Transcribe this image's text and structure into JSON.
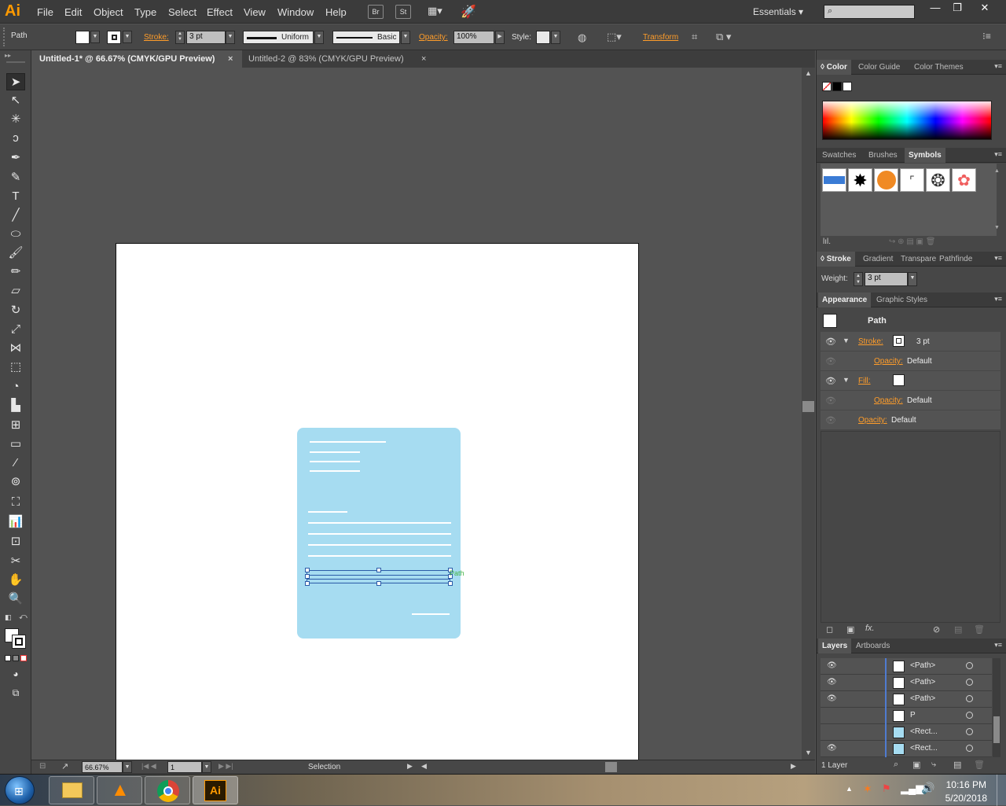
{
  "menubar": {
    "logo": "Ai",
    "items": [
      "File",
      "Edit",
      "Object",
      "Type",
      "Select",
      "Effect",
      "View",
      "Window",
      "Help"
    ],
    "bridge_icon": "Br",
    "stock_icon": "St",
    "workspace": "Essentials"
  },
  "controlbar": {
    "object_type": "Path",
    "stroke_label": "Stroke:",
    "stroke_weight": "3 pt",
    "profile_uniform": "Uniform",
    "brush_basic": "Basic",
    "opacity_label": "Opacity:",
    "opacity_value": "100%",
    "style_label": "Style:",
    "transform_label": "Transform"
  },
  "tabs": [
    {
      "label": "Untitled-1* @ 66.67% (CMYK/GPU Preview)",
      "close": "×"
    },
    {
      "label": "Untitled-2 @ 83% (CMYK/GPU Preview)",
      "close": "×"
    }
  ],
  "canvas": {
    "selection_hint": "Path"
  },
  "statusbar": {
    "zoom": "66.67%",
    "artboard_number": "1",
    "tool_name": "Selection"
  },
  "panels": {
    "color_tabs": [
      "Color",
      "Color Guide",
      "Color Themes"
    ],
    "symbol_tabs": [
      "Swatches",
      "Brushes",
      "Symbols"
    ],
    "stroke_tabs": [
      "Stroke",
      "Gradient",
      "Transpare",
      "Pathfinde"
    ],
    "stroke_weight_label": "Weight:",
    "stroke_weight_value": "3 pt",
    "appearance_tabs": [
      "Appearance",
      "Graphic Styles"
    ],
    "appearance": {
      "title": "Path",
      "stroke_label": "Stroke:",
      "stroke_value": "3 pt",
      "stroke_opacity_label": "Opacity:",
      "stroke_opacity_value": "Default",
      "fill_label": "Fill:",
      "fill_opacity_label": "Opacity:",
      "fill_opacity_value": "Default",
      "opacity_label": "Opacity:",
      "opacity_value": "Default"
    },
    "layers_tabs": [
      "Layers",
      "Artboards"
    ],
    "layers": [
      {
        "name": "<Path>",
        "visible": true,
        "thumb": "#ffffff"
      },
      {
        "name": "<Path>",
        "visible": true,
        "thumb": "#ffffff"
      },
      {
        "name": "<Path>",
        "visible": true,
        "thumb": "#ffffff"
      },
      {
        "name": "P",
        "visible": false,
        "thumb": "#ffffff"
      },
      {
        "name": "<Rect...",
        "visible": false,
        "thumb": "#a6dcf1"
      },
      {
        "name": "<Rect...",
        "visible": true,
        "thumb": "#a6dcf1"
      }
    ],
    "layers_count": "1 Layer"
  },
  "taskbar": {
    "time": "10:16 PM",
    "date": "5/20/2018",
    "ai_label": "Ai"
  },
  "colors": {
    "accent": "#ff9a00",
    "card": "#a6dcf1",
    "selection": "#2b5ba8"
  }
}
